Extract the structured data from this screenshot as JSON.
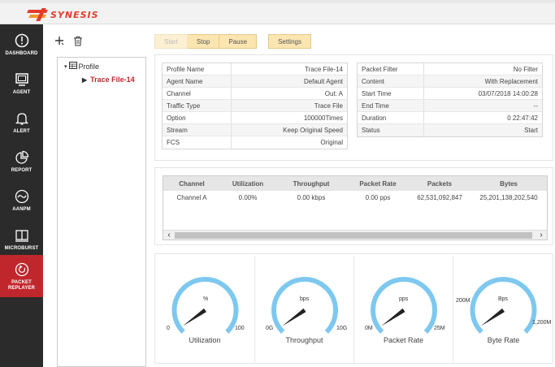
{
  "app": {
    "logo_text": "SYNESIS"
  },
  "sidebar": {
    "items": [
      {
        "label": "DASHBOARD",
        "icon": "dashboard-icon",
        "active": false
      },
      {
        "label": "AGENT",
        "icon": "monitor-icon",
        "active": false
      },
      {
        "label": "ALERT",
        "icon": "bell-icon",
        "active": false
      },
      {
        "label": "REPORT",
        "icon": "pie-chart-icon",
        "active": false
      },
      {
        "label": "AANPM",
        "icon": "wave-icon",
        "active": false
      },
      {
        "label": "MICROBURST",
        "icon": "book-icon",
        "active": false
      },
      {
        "label": "PACKET REPLAYER",
        "icon": "replay-icon",
        "active": true
      }
    ]
  },
  "tree": {
    "add_icon": "plus-icon",
    "delete_icon": "trash-icon",
    "root_label": "Profile",
    "child_label": "Trace File-14"
  },
  "controls": {
    "start": "Start",
    "stop": "Stop",
    "pause": "Pause",
    "settings": "Settings"
  },
  "profile_info": [
    {
      "key": "Profile Name",
      "value": "Trace File-14"
    },
    {
      "key": "Agent Name",
      "value": "Default Agent"
    },
    {
      "key": "Channel",
      "value": "Out: A"
    },
    {
      "key": "Traffic Type",
      "value": "Trace File"
    },
    {
      "key": "Option",
      "value": "100000Times"
    },
    {
      "key": "Stream",
      "value": "Keep Original Speed"
    },
    {
      "key": "FCS",
      "value": "Original"
    }
  ],
  "status_info": [
    {
      "key": "Packet Filter",
      "value": "No Filter"
    },
    {
      "key": "Content",
      "value": "With Replacement"
    },
    {
      "key": "Start Time",
      "value": "03/07/2018 14:00:28"
    },
    {
      "key": "End Time",
      "value": "--"
    },
    {
      "key": "Duration",
      "value": "0 22:47:42"
    },
    {
      "key": "Status",
      "value": "Start"
    }
  ],
  "stats_table": {
    "columns": [
      "Channel",
      "Utilization",
      "Throughput",
      "Packet Rate",
      "Packets",
      "Bytes"
    ],
    "rows": [
      [
        "Channel A",
        "0.00%",
        "0.00 kbps",
        "0.00 pps",
        "62,531,092,847",
        "25,201,138,202,540"
      ]
    ]
  },
  "gauges": [
    {
      "title": "Utilization",
      "unit": "%",
      "min": "0",
      "max": "100",
      "value": 0.0,
      "min_num": 0,
      "max_num": 100
    },
    {
      "title": "Throughput",
      "unit": "bps",
      "min": "0G",
      "max": "10G",
      "value": 0.0,
      "min_num": 0,
      "max_num": 10
    },
    {
      "title": "Packet Rate",
      "unit": "pps",
      "min": "0M",
      "max": "25M",
      "value": 0.0,
      "min_num": 0,
      "max_num": 25
    },
    {
      "title": "Byte Rate",
      "unit": "Bps",
      "min": "200M",
      "max": "1,200M",
      "value": 200,
      "min_num": 200,
      "max_num": 1200
    }
  ],
  "colors": {
    "accent_red": "#c0272d",
    "gauge_arc": "#7ec8f0",
    "button_fill": "#fbe5b0",
    "sidebar_bg": "#2b2b2b"
  }
}
